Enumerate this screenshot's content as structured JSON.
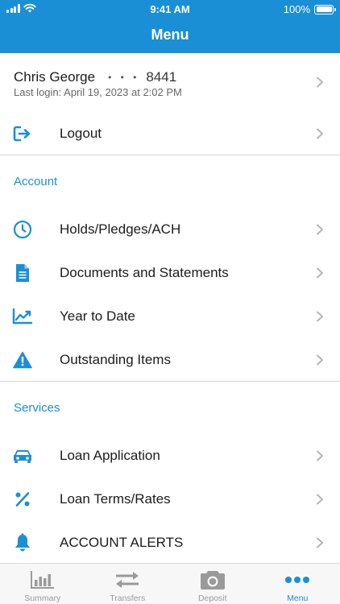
{
  "status_bar": {
    "time": "9:41 AM",
    "battery": "100%"
  },
  "header": {
    "title": "Menu"
  },
  "profile": {
    "name": "Chris George",
    "masked_dots": "• • •",
    "account_suffix": "8441",
    "last_login": "Last login: April 19, 2023 at 2:02 PM"
  },
  "logout": {
    "label": "Logout",
    "icon": "logout-icon"
  },
  "account_section": {
    "title": "Account",
    "items": [
      {
        "label": "Holds/Pledges/ACH",
        "icon": "clock-icon"
      },
      {
        "label": "Documents and Statements",
        "icon": "document-icon"
      },
      {
        "label": "Year to Date",
        "icon": "trend-chart-icon"
      },
      {
        "label": "Outstanding Items",
        "icon": "warning-icon"
      }
    ]
  },
  "services_section": {
    "title": "Services",
    "items": [
      {
        "label": "Loan Application",
        "icon": "car-icon"
      },
      {
        "label": "Loan Terms/Rates",
        "icon": "percent-icon"
      },
      {
        "label": "ACCOUNT ALERTS",
        "icon": "bell-icon"
      }
    ]
  },
  "tab_bar": {
    "tabs": [
      {
        "label": "Summary",
        "icon": "bar-chart-icon",
        "active": false
      },
      {
        "label": "Transfers",
        "icon": "transfer-arrows-icon",
        "active": false
      },
      {
        "label": "Deposit",
        "icon": "camera-icon",
        "active": false
      },
      {
        "label": "Menu",
        "icon": "more-dots-icon",
        "active": true
      }
    ]
  },
  "colors": {
    "brand": "#1b8fd6",
    "divider": "#d6d6d9",
    "tab_inactive": "#9a9a9a"
  }
}
